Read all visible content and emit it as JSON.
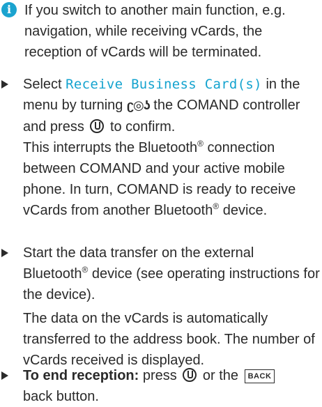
{
  "note": {
    "text": "If you switch to another main function, e.g. navigation, while receiving vCards, the reception of vCards will be terminated."
  },
  "step1": {
    "pre": "Select ",
    "menu_item": "Receive Business Card(s)",
    "post_menu": " in the menu by turning ",
    "post_rotary": " the COMAND controller and press ",
    "post_press": " to confirm.",
    "result_pre": "This interrupts the Bluetooth",
    "result_mid": " connection between COMAND and your active mobile phone. In turn, COMAND is ready to receive vCards from another Bluetooth",
    "result_post": " device."
  },
  "step2": {
    "pre": "Start the data transfer on the external Bluetooth",
    "post": " device (see operating instructions for the device).",
    "result": "The data on the vCards is automatically transferred to the address book. The number of vCards received is displayed."
  },
  "step3": {
    "bold": "To end reception:",
    "mid": " press ",
    "or": " or the ",
    "button": "BACK",
    "post": "back button."
  },
  "symbols": {
    "info": "i",
    "registered": "®",
    "rotary_left": "ʗ",
    "rotary_center": "◎",
    "rotary_right": "ʖ"
  },
  "colors": {
    "accent": "#14a3cf",
    "info_icon": "#1ba3cf",
    "text": "#2a2a2a"
  }
}
